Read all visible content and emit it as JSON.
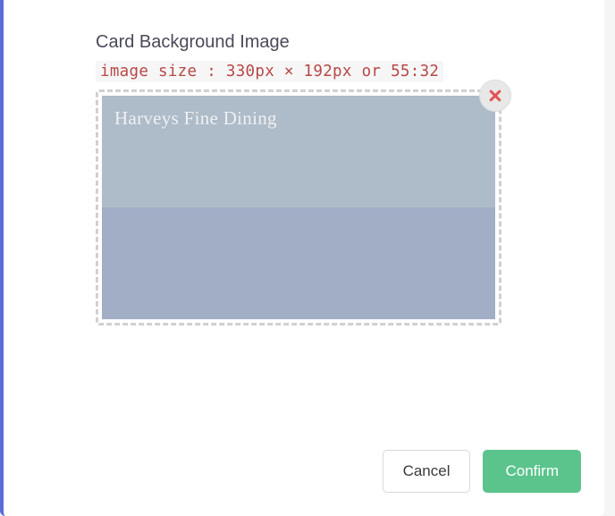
{
  "section": {
    "title": "Card Background Image",
    "size_hint": "image size : 330px × 192px or 55:32"
  },
  "preview": {
    "caption": "Harveys Fine Dining"
  },
  "footer": {
    "cancel_label": "Cancel",
    "confirm_label": "Confirm"
  }
}
